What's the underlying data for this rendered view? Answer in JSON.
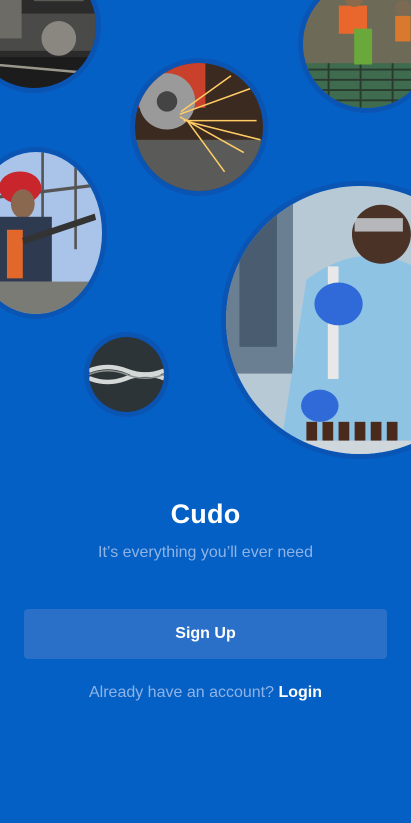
{
  "app": {
    "name": "Cudo",
    "tagline": "It’s everything you’ll ever need"
  },
  "actions": {
    "signup_label": "Sign Up",
    "account_prompt": "Already have an account?",
    "login_label": "Login"
  },
  "images": [
    {
      "name": "factory-machinery-photo",
      "subject": "industrial machinery"
    },
    {
      "name": "construction-worker-rebar-photo",
      "subject": "construction worker on rebar"
    },
    {
      "name": "angle-grinder-sparks-photo",
      "subject": "grinder with sparks"
    },
    {
      "name": "welder-hardhat-photo",
      "subject": "worker in red hardhat"
    },
    {
      "name": "steel-cable-photo",
      "subject": "braided steel cable"
    },
    {
      "name": "lab-scientist-pipette-photo",
      "subject": "scientist with pipette"
    }
  ],
  "colors": {
    "background": "#0460c4",
    "button": "#2a70c8",
    "muted_text": "#8fb3e6",
    "text": "#ffffff"
  }
}
